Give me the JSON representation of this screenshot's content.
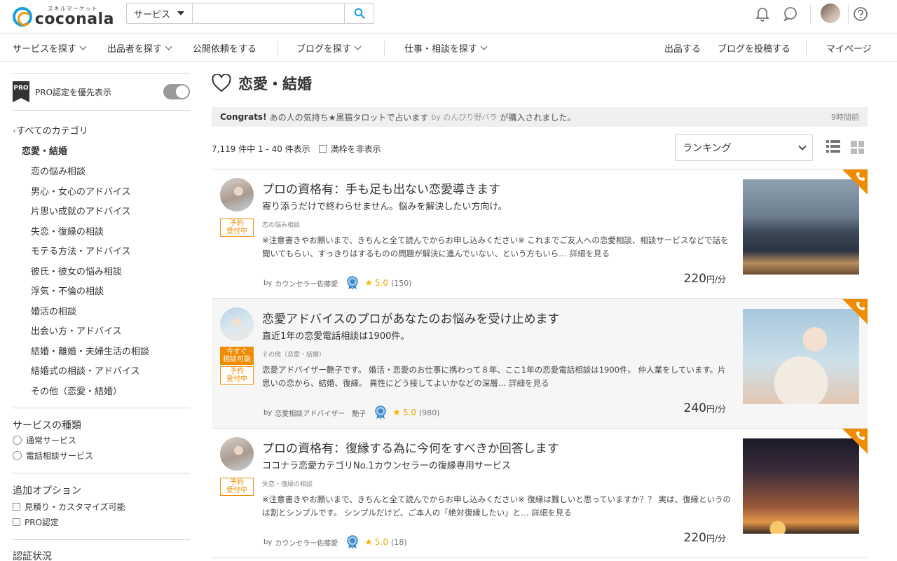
{
  "header": {
    "logo_sub": "スキルマーケット",
    "logo_name": "coconala",
    "search_category": "サービス",
    "search_placeholder": ""
  },
  "nav": {
    "items": [
      "サービスを探す",
      "出品者を探す",
      "公開依頼をする",
      "ブログを探す",
      "仕事・相談を探す"
    ],
    "right": [
      "出品する",
      "ブログを投稿する",
      "マイページ"
    ]
  },
  "sidebar": {
    "pro_badge": "PRO",
    "pro_label": "PRO認定を優先表示",
    "all_categories": "すべてのカテゴリ",
    "current_category": "恋愛・結婚",
    "subcategories": [
      "恋の悩み相談",
      "男心・女心のアドバイス",
      "片思い成就のアドバイス",
      "失恋・復縁の相談",
      "モテる方法・アドバイス",
      "彼氏・彼女の悩み相談",
      "浮気・不倫の相談",
      "婚活の相談",
      "出会い方・アドバイス",
      "結婚・離婚・夫婦生活の相談",
      "結婚式の相談・アドバイス",
      "その他（恋愛・結婚）"
    ],
    "service_type_heading": "サービスの種類",
    "service_types": [
      "通常サービス",
      "電話相談サービス"
    ],
    "options_heading": "追加オプション",
    "options": [
      "見積り・カスタマイズ可能",
      "PRO認定"
    ],
    "cert_heading": "認証状況"
  },
  "main": {
    "title": "恋愛・結婚",
    "congrats": {
      "label": "Congrats!",
      "text": "あの人の気持ち★黒猫タロットで占います",
      "by": "by のんびり野バラ",
      "suffix": "が購入されました。",
      "time": "9時間前"
    },
    "count_text": "7,119 件中 1 - 40 件表示",
    "hide_full_label": "満枠を非表示",
    "sort_value": "ランキング"
  },
  "cards": [
    {
      "title": "プロの資格有：手も足も出ない恋愛導きます",
      "subtitle": "寄り添うだけで終わらせません。悩みを解決したい方向け。",
      "badges": [
        {
          "text": "予約\n受付中",
          "solid": false
        }
      ],
      "category": "恋の悩み相談",
      "description": "※注意書きやお願いまで、きちんと全て読んでからお申し込みください※ これまでご友人への恋愛相談、相談サービスなどで話を聞いてもらい、すっきりはするものの問題が解決に進んでいない、という方もいら…",
      "more": "詳細を見る",
      "seller": "カウンセラー佐藤愛",
      "rating": "5.0",
      "reviews": "(150)",
      "price": "220",
      "price_unit": "円/分"
    },
    {
      "title": "恋愛アドバイスのプロがあなたのお悩みを受け止めます",
      "subtitle": "直近1年の恋愛電話相談は1900件。",
      "badges": [
        {
          "text": "今すぐ\n相談可能",
          "solid": true
        },
        {
          "text": "予約\n受付中",
          "solid": false
        }
      ],
      "category": "その他（恋愛・結婚）",
      "description": "恋愛アドバイザー艶子です。 婚活・恋愛のお仕事に携わって８年、ここ1年の恋愛電話相談は1900件。 仲人業をしています。片思いの恋から、結婚、復縁。 異性にどう接してよいかなどの深層…",
      "more": "詳細を見る",
      "seller": "恋愛相談アドバイザー　艶子",
      "rating": "5.0",
      "reviews": "(980)",
      "price": "240",
      "price_unit": "円/分"
    },
    {
      "title": "プロの資格有：復縁する為に今何をすべきか回答します",
      "subtitle": "ココナラ恋愛カテゴリNo.1カウンセラーの復縁専用サービス",
      "badges": [
        {
          "text": "予約\n受付中",
          "solid": false
        }
      ],
      "category": "失恋・復縁の相談",
      "description": "※注意書きやお願いまで、きちんと全て読んでからお申し込みください※ 復縁は難しいと思っていますか？？ 実は、復縁というのは割とシンプルです。 シンプルだけど、ご本人の「絶対復縁したい」と…",
      "more": "詳細を見る",
      "seller": "カウンセラー佐藤愛",
      "rating": "5.0",
      "reviews": "(18)",
      "price": "220",
      "price_unit": "円/分"
    }
  ],
  "colors": {
    "accent": "#f08c00",
    "brand_blue": "#1aa0e0",
    "star": "#f5b800"
  }
}
